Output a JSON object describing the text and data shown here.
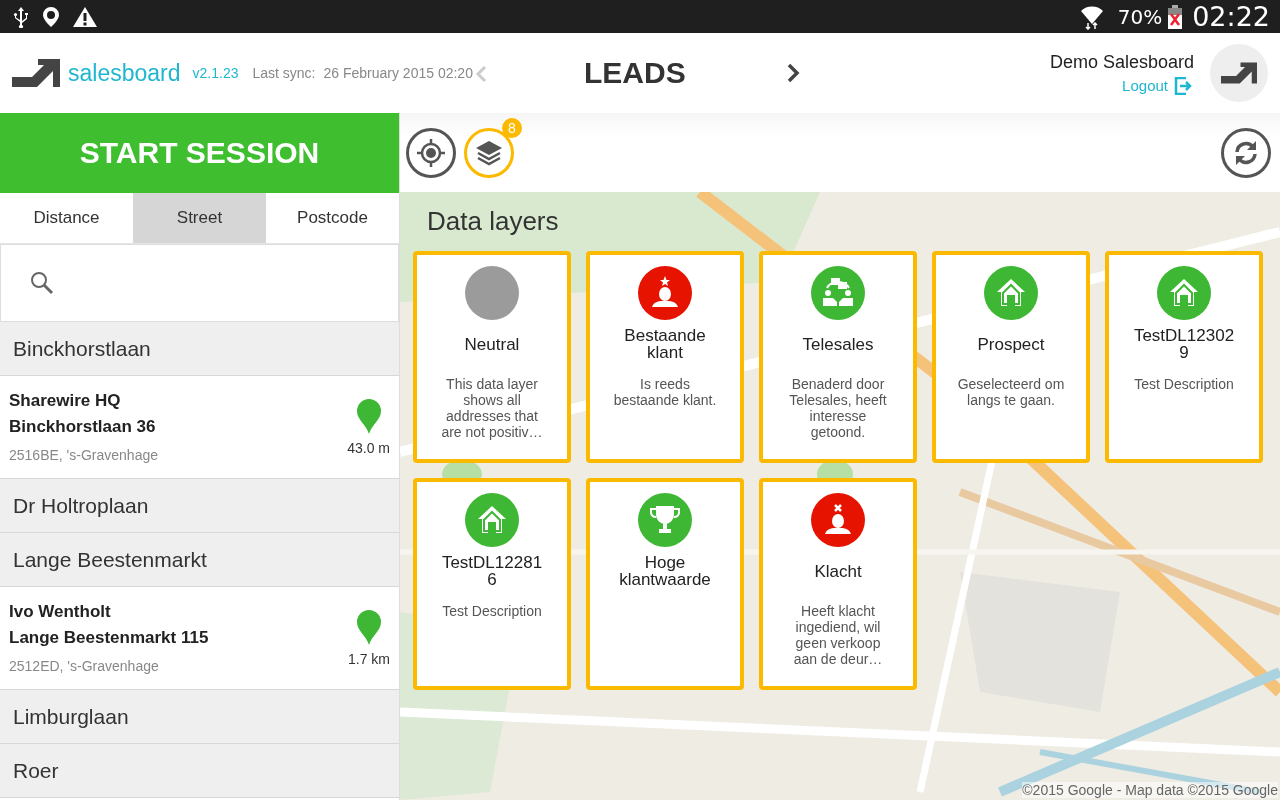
{
  "status_bar": {
    "battery": "70%",
    "time": "02:22"
  },
  "header": {
    "brand": "salesboard",
    "version": "v2.1.23",
    "sync_label": "Last sync:",
    "sync_time": "26 February 2015 02:20",
    "title": "LEADS",
    "user": "Demo Salesboard",
    "logout": "Logout"
  },
  "sidebar": {
    "start_button": "START SESSION",
    "tabs": [
      {
        "label": "Distance",
        "selected": false
      },
      {
        "label": "Street",
        "selected": true
      },
      {
        "label": "Postcode",
        "selected": false
      }
    ],
    "items": [
      {
        "kind": "street",
        "name": "Binckhorstlaan"
      },
      {
        "kind": "lead",
        "name": "Sharewire HQ",
        "address": "Binckhorstlaan 36",
        "city": "2516BE, 's-Gravenhage",
        "distance": "43.0 m"
      },
      {
        "kind": "street",
        "name": "Dr Holtroplaan"
      },
      {
        "kind": "street",
        "name": "Lange Beestenmarkt"
      },
      {
        "kind": "lead",
        "name": "Ivo Wentholt",
        "address": "Lange Beestenmarkt 115",
        "city": "2512ED, 's-Gravenhage",
        "distance": "1.7 km"
      },
      {
        "kind": "street",
        "name": "Limburglaan"
      },
      {
        "kind": "street",
        "name": "Roer"
      }
    ]
  },
  "map": {
    "layers_badge": "8",
    "panel_title": "Data layers",
    "attribution": "©2015 Google - Map data ©2015 Google",
    "layers": [
      {
        "kind": "neutral",
        "color": "#9b9b9b",
        "title": "Neutral",
        "description": "This data layer shows all addresses that are not positiv…"
      },
      {
        "kind": "customer",
        "color": "#e61300",
        "title": "Bestaande klant",
        "description": "Is reeds bestaande klant."
      },
      {
        "kind": "conversation",
        "color": "#3db734",
        "title": "Telesales",
        "description": "Benaderd door Telesales, heeft interesse getoond."
      },
      {
        "kind": "house",
        "color": "#3db734",
        "title": "Prospect",
        "description": "Geselecteerd om langs te gaan."
      },
      {
        "kind": "house",
        "color": "#3db734",
        "title": "TestDL123029",
        "description": "Test Description"
      },
      {
        "kind": "house",
        "color": "#3db734",
        "title": "TestDL122816",
        "description": "Test Description"
      },
      {
        "kind": "trophy",
        "color": "#3db734",
        "title": "Hoge klantwaarde"
      },
      {
        "kind": "complaint",
        "color": "#e61300",
        "title": "Klacht",
        "description": "Heeft klacht ingediend, wil geen verkoop aan de deur…"
      }
    ]
  }
}
